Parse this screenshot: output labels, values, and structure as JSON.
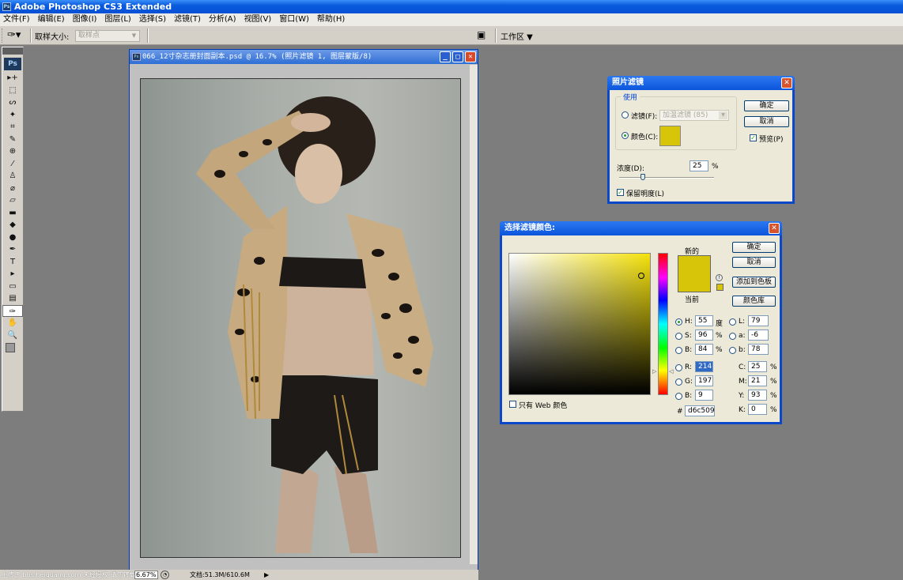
{
  "app": {
    "title": "Adobe Photoshop CS3 Extended",
    "logo": "Ps"
  },
  "menu": [
    "文件(F)",
    "编辑(E)",
    "图像(I)",
    "图层(L)",
    "选择(S)",
    "滤镜(T)",
    "分析(A)",
    "视图(V)",
    "窗口(W)",
    "帮助(H)"
  ],
  "options": {
    "sample_size_label": "取样大小:",
    "sample_size_value": "取样点",
    "workspace_label": "工作区"
  },
  "toolbox": {
    "tools": [
      "move",
      "marquee",
      "lasso",
      "magic-wand",
      "crop",
      "slice",
      "healing",
      "brush",
      "stamp",
      "history-brush",
      "eraser",
      "gradient",
      "blur",
      "dodge",
      "pen",
      "type",
      "path-select",
      "shape",
      "notes",
      "eyedropper",
      "hand",
      "zoom"
    ],
    "selected": "eyedropper",
    "glyphs": [
      "▸+",
      "⬚",
      "ᔕ",
      "✦",
      "⌗",
      "✎",
      "⊕",
      "⁄",
      "♙",
      "⌀",
      "▱",
      "▬",
      "◆",
      "●",
      "✒",
      "T",
      "▸",
      "▭",
      "▤",
      "✑",
      "✋",
      "🔍"
    ],
    "type_label": "T"
  },
  "document": {
    "title": "066_12寸杂志册封面副本.psd @ 16.7% (照片滤镜 1, 图层蒙版/8)"
  },
  "status": {
    "watermark": "上传于 bbs.heiguang.com 未经授权 请勿转载",
    "zoom": "6.67%",
    "doc_size": "文档:51.3M/610.6M"
  },
  "photo_filter": {
    "title": "照片滤镜",
    "group_label": "使用",
    "filter_label": "滤镜(F):",
    "filter_value": "加温滤镜 (85)",
    "color_label": "颜色(C):",
    "color": "#d6c509",
    "density_label": "浓度(D):",
    "density_value": "25",
    "density_unit": "%",
    "density": 25,
    "preserve_label": "保留明度(L)",
    "ok": "确定",
    "cancel": "取消",
    "preview_label": "预览(P)"
  },
  "color_picker": {
    "title": "选择滤镜颜色:",
    "new_label": "新的",
    "current_label": "当前",
    "ok": "确定",
    "cancel": "取消",
    "add_swatch": "添加到色板",
    "color_libraries": "颜色库",
    "web_only": "只有 Web 颜色",
    "hex_label": "#",
    "hex": "d6c509",
    "fields": {
      "H": {
        "label": "H:",
        "value": "55",
        "unit": "度"
      },
      "S": {
        "label": "S:",
        "value": "96",
        "unit": "%"
      },
      "B": {
        "label": "B:",
        "value": "84",
        "unit": "%"
      },
      "R": {
        "label": "R:",
        "value": "214"
      },
      "G": {
        "label": "G:",
        "value": "197"
      },
      "Bl": {
        "label": "B:",
        "value": "9"
      },
      "L": {
        "label": "L:",
        "value": "79"
      },
      "a": {
        "label": "a:",
        "value": "-6"
      },
      "b": {
        "label": "b:",
        "value": "78"
      },
      "C": {
        "label": "C:",
        "value": "25",
        "unit": "%"
      },
      "M": {
        "label": "M:",
        "value": "21",
        "unit": "%"
      },
      "Y": {
        "label": "Y:",
        "value": "93",
        "unit": "%"
      },
      "K": {
        "label": "K:",
        "value": "0",
        "unit": "%"
      }
    }
  }
}
